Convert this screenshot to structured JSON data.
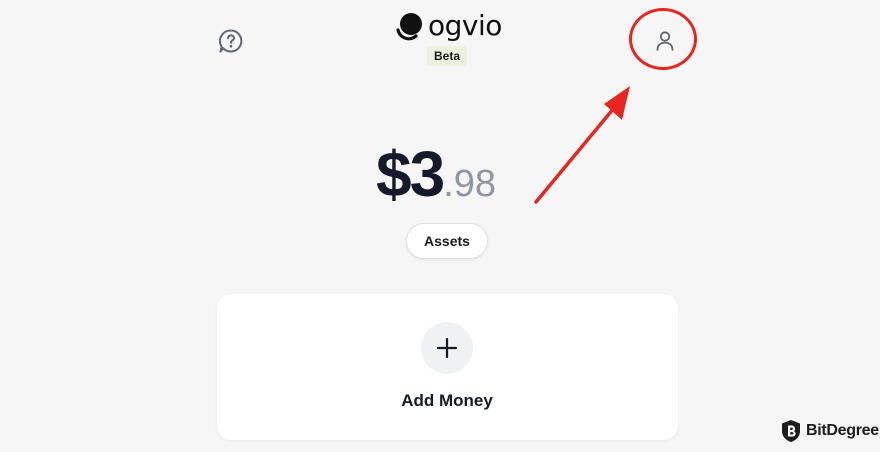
{
  "header": {
    "help_icon": "help-chat-icon",
    "logo_text": "ogvio",
    "beta_label": "Beta",
    "profile_icon": "user-icon"
  },
  "balance": {
    "whole": "$3",
    "cents": ".98"
  },
  "assets_button": {
    "label": "Assets"
  },
  "add_money": {
    "icon": "plus-icon",
    "label": "Add Money"
  },
  "annotation": {
    "highlight_color": "#e8261f"
  },
  "watermark": {
    "text": "BitDegree"
  },
  "colors": {
    "background": "#f6f6f6",
    "text_primary": "#141a2a",
    "text_muted": "#8f96a6",
    "beta_badge": "#edf2df"
  }
}
